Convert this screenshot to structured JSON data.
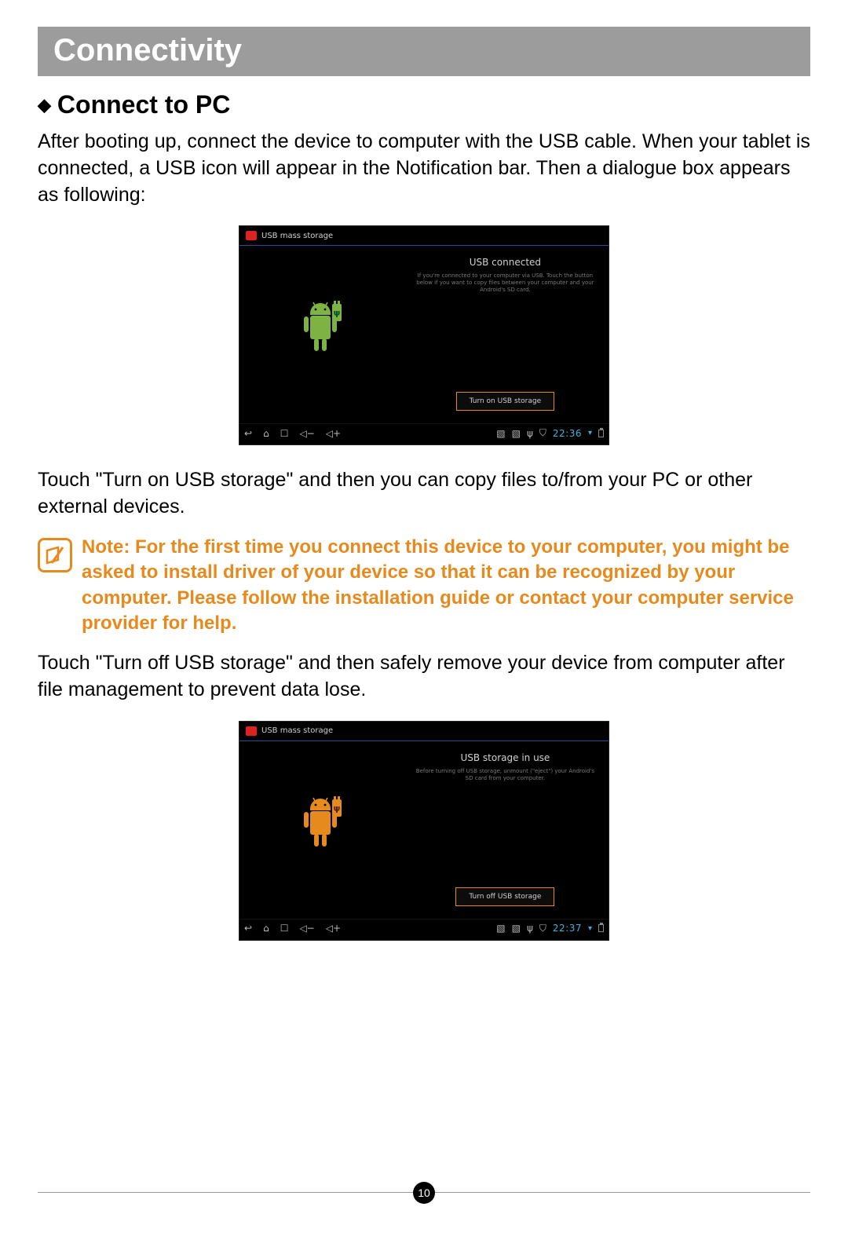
{
  "section_title": "Connectivity",
  "subheading": "Connect to PC",
  "intro_text": "After booting up, connect the device to computer with the USB cable. When your tablet is connected, a USB icon will appear in the Notification bar. Then a dialogue box appears as following:",
  "screenshot1": {
    "titlebar": "USB mass storage",
    "status_title": "USB connected",
    "status_text": "If you're connected to your computer via USB. Touch the button below if you want to copy files between your computer and your Android's SD card.",
    "button_label": "Turn on USB storage",
    "clock": "22:36"
  },
  "mid_text": "Touch \"Turn on USB storage\" and then you can copy files to/from your PC or other external devices.",
  "note_text": "Note: For the first time you connect this device to your computer, you might be asked to install driver of your device so that it can be recognized by your computer. Please follow the installation guide or contact your computer service provider for help.",
  "after_note_text": "Touch \"Turn off USB storage\" and then safely remove your device from computer after file management to prevent data lose.",
  "screenshot2": {
    "titlebar": "USB mass storage",
    "status_title": "USB storage in use",
    "status_text": "Before turning off USB storage, unmount (\"eject\") your Android's SD card from your computer.",
    "button_label": "Turn off USB storage",
    "clock": "22:37"
  },
  "page_number": "10"
}
